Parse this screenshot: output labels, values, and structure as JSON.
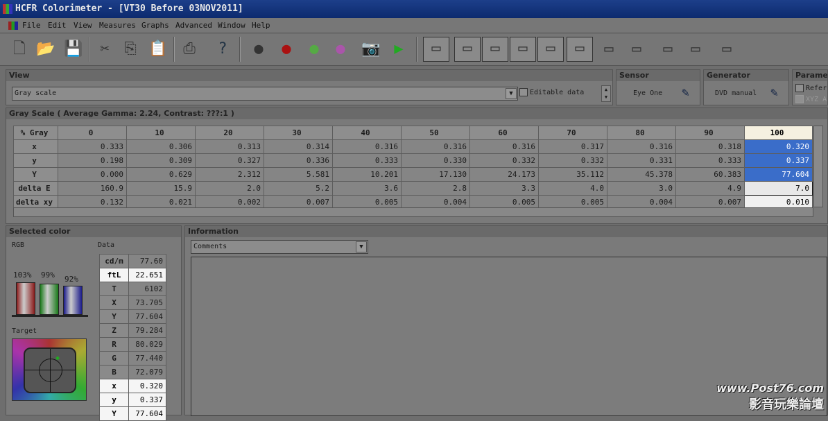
{
  "window": {
    "title": "HCFR Colorimeter - [VT30 Before 03NOV2011]"
  },
  "menu": [
    "File",
    "Edit",
    "View",
    "Measures",
    "Graphs",
    "Advanced",
    "Window",
    "Help"
  ],
  "view": {
    "header": "View",
    "selected": "Gray scale",
    "editable_label": "Editable data"
  },
  "sensor": {
    "header": "Sensor",
    "name": "Eye One"
  },
  "generator": {
    "header": "Generator",
    "name": "DVD manual"
  },
  "param": {
    "header": "Paramet",
    "opt1": "Refer",
    "opt2": "XYZ A"
  },
  "grayscale": {
    "title": "Gray Scale ( Average Gamma: 2.24, Contrast: ???:1 )",
    "corner": "% Gray",
    "columns": [
      "0",
      "10",
      "20",
      "30",
      "40",
      "50",
      "60",
      "70",
      "80",
      "90",
      "100"
    ],
    "rows": [
      {
        "label": "x",
        "values": [
          "0.333",
          "0.306",
          "0.313",
          "0.314",
          "0.316",
          "0.316",
          "0.316",
          "0.317",
          "0.316",
          "0.318",
          "0.320"
        ]
      },
      {
        "label": "y",
        "values": [
          "0.198",
          "0.309",
          "0.327",
          "0.336",
          "0.333",
          "0.330",
          "0.332",
          "0.332",
          "0.331",
          "0.333",
          "0.337"
        ]
      },
      {
        "label": "Y",
        "values": [
          "0.000",
          "0.629",
          "2.312",
          "5.581",
          "10.201",
          "17.130",
          "24.173",
          "35.112",
          "45.378",
          "60.383",
          "77.604"
        ]
      },
      {
        "label": "delta E",
        "values": [
          "160.9",
          "15.9",
          "2.0",
          "5.2",
          "3.6",
          "2.8",
          "3.3",
          "4.0",
          "3.0",
          "4.9",
          "7.0"
        ]
      },
      {
        "label": "delta xy",
        "values": [
          "0.132",
          "0.021",
          "0.002",
          "0.007",
          "0.005",
          "0.004",
          "0.005",
          "0.005",
          "0.004",
          "0.007",
          "0.010"
        ]
      }
    ]
  },
  "selected_color": {
    "header": "Selected color",
    "rgb_label": "RGB",
    "data_label": "Data",
    "target_label": "Target",
    "bars": [
      {
        "pct": "103%",
        "level": 1.03,
        "color": "#8a1a1a"
      },
      {
        "pct": "99%",
        "level": 0.99,
        "color": "#1a7a1a"
      },
      {
        "pct": "92%",
        "level": 0.92,
        "color": "#1a1a8a"
      }
    ],
    "data": [
      {
        "k": "cd/m",
        "v": "77.60"
      },
      {
        "k": "ftL",
        "v": "22.651",
        "hl": true
      },
      {
        "k": "T",
        "v": "6102"
      },
      {
        "k": "X",
        "v": "73.705"
      },
      {
        "k": "Y",
        "v": "77.604"
      },
      {
        "k": "Z",
        "v": "79.284"
      },
      {
        "k": "R",
        "v": "80.029"
      },
      {
        "k": "G",
        "v": "77.440"
      },
      {
        "k": "B",
        "v": "72.079"
      },
      {
        "k": "x",
        "v": "0.320",
        "hl": true
      },
      {
        "k": "y",
        "v": "0.337",
        "hl": true
      },
      {
        "k": "Y",
        "v": "77.604",
        "hl": true
      }
    ]
  },
  "information": {
    "header": "Information",
    "combo": "Comments"
  },
  "watermark": {
    "line1": "www.Post76.com",
    "line2": "影音玩樂論壇"
  }
}
